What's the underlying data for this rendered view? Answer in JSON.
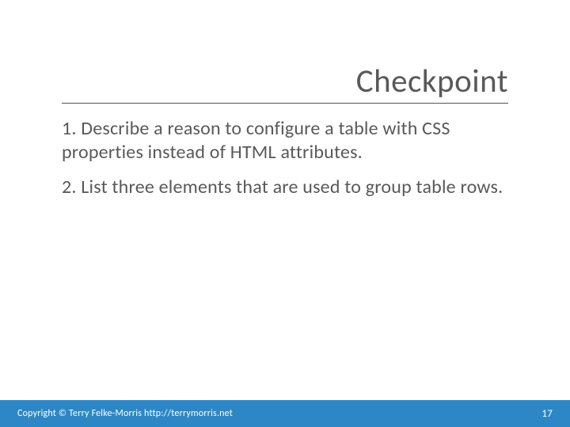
{
  "title": "Checkpoint",
  "items": [
    "1. Describe a reason to configure a table with CSS properties instead of HTML attributes.",
    "2. List three elements that are used to group table rows."
  ],
  "footer": {
    "copyright": "Copyright © Terry Felke-Morris http://terrymorris.net",
    "page": "17"
  }
}
